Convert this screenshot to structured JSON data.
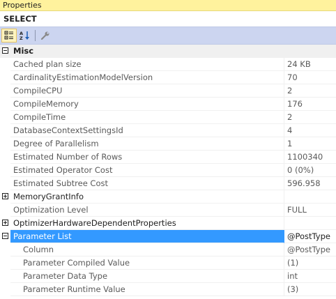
{
  "window": {
    "title": "Properties"
  },
  "object": {
    "name": "SELECT"
  },
  "toolbar": {
    "categorized_icon": "categorized-icon",
    "alphabetical_icon": "alphabetical-icon",
    "property_pages_icon": "wrench-icon"
  },
  "colors": {
    "selection": "#3399ff",
    "toolbar": "#ccd5f0",
    "title_bar": "#fff29d"
  },
  "misc": {
    "label": "Misc"
  },
  "props": [
    {
      "name": "Cached plan size",
      "value": "24 KB"
    },
    {
      "name": "CardinalityEstimationModelVersion",
      "value": "70"
    },
    {
      "name": "CompileCPU",
      "value": "2"
    },
    {
      "name": "CompileMemory",
      "value": "176"
    },
    {
      "name": "CompileTime",
      "value": "2"
    },
    {
      "name": "DatabaseContextSettingsId",
      "value": "4"
    },
    {
      "name": "Degree of Parallelism",
      "value": "1"
    },
    {
      "name": "Estimated Number of Rows",
      "value": "1100340"
    },
    {
      "name": "Estimated Operator Cost",
      "value": "0 (0%)"
    },
    {
      "name": "Estimated Subtree Cost",
      "value": "596.958"
    },
    {
      "name": "MemoryGrantInfo",
      "value": ""
    },
    {
      "name": "Optimization Level",
      "value": "FULL"
    },
    {
      "name": "OptimizerHardwareDependentProperties",
      "value": ""
    },
    {
      "name": "Parameter List",
      "value": "@PostType"
    }
  ],
  "parameter_list": [
    {
      "name": "Column",
      "value": "@PostType"
    },
    {
      "name": "Parameter Compiled Value",
      "value": "(1)"
    },
    {
      "name": "Parameter Data Type",
      "value": "int"
    },
    {
      "name": "Parameter Runtime Value",
      "value": "(3)"
    }
  ]
}
